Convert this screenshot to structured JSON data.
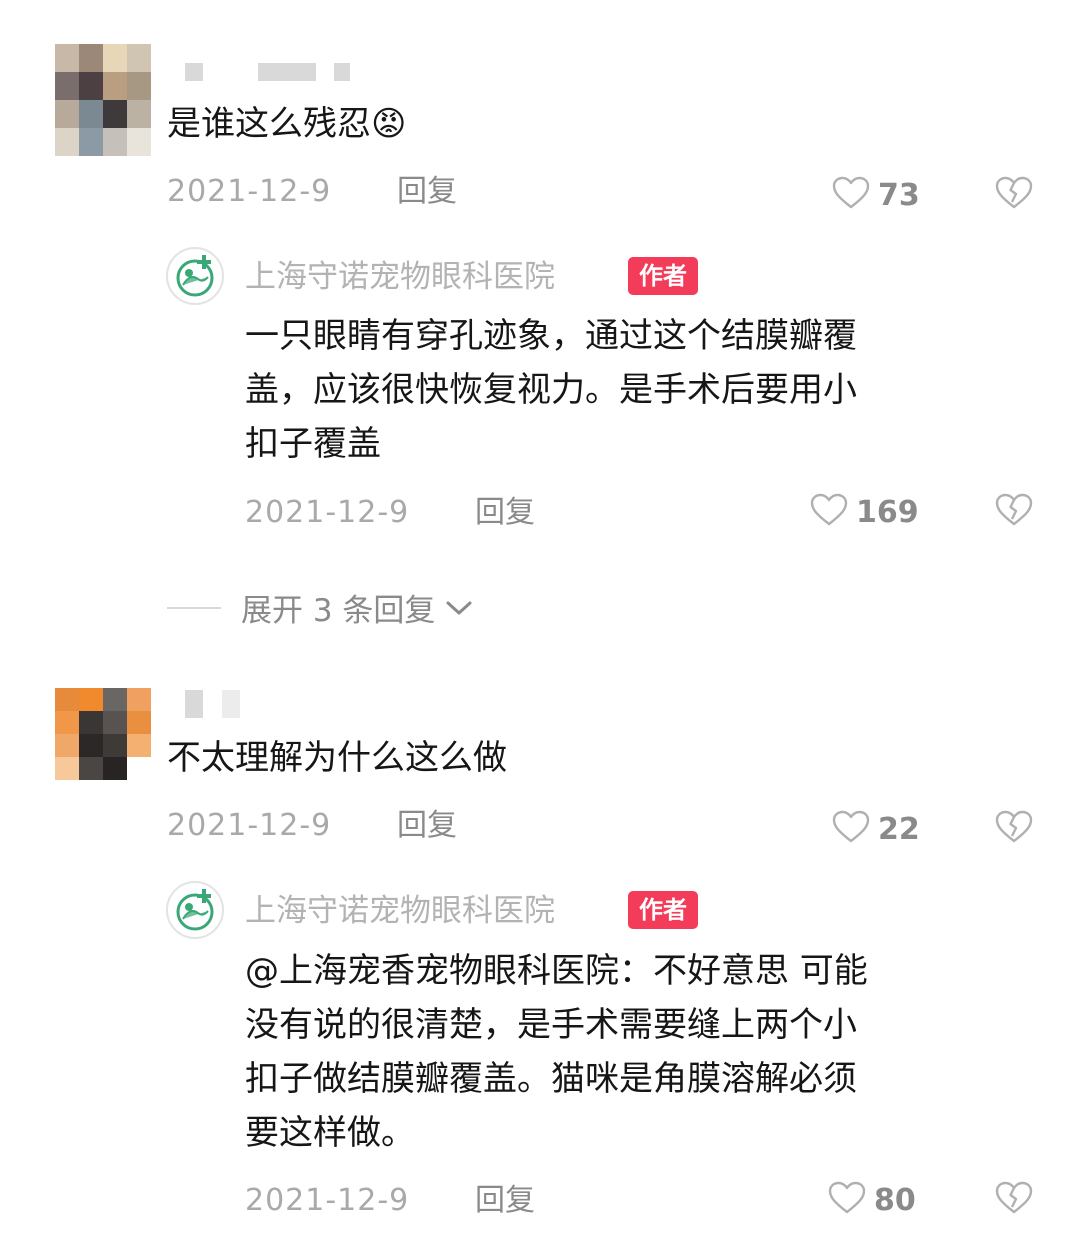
{
  "comments": [
    {
      "username": "",
      "text": "是谁这么残忍",
      "emoji": "😡",
      "date": "2021-12-9",
      "reply_label": "回复",
      "likes": "73",
      "author_reply": {
        "name": "上海守诺宠物眼科医院",
        "badge": "作者",
        "lines": [
          "一只眼睛有穿孔迹象，通过这个结膜瓣覆",
          "盖，应该很快恢复视力。是手术后要用小",
          "扣子覆盖"
        ],
        "date": "2021-12-9",
        "reply_label": "回复",
        "likes": "169"
      },
      "expand": {
        "label": "展开 3 条回复"
      }
    },
    {
      "username": "",
      "text": "不太理解为什么这么做",
      "date": "2021-12-9",
      "reply_label": "回复",
      "likes": "22",
      "author_reply": {
        "name": "上海守诺宠物眼科医院",
        "badge": "作者",
        "lines": [
          "@上海宠香宠物眼科医院：不好意思 可能",
          "没有说的很清楚，是手术需要缝上两个小",
          "扣子做结膜瓣覆盖。猫咪是角膜溶解必须",
          "要这样做。"
        ],
        "date": "2021-12-9",
        "reply_label": "回复",
        "likes": "80"
      }
    }
  ],
  "icons": {
    "like": "heart-outline-icon",
    "dislike": "broken-heart-icon",
    "expand": "chevron-down-icon"
  },
  "colors": {
    "badge": "#f23c5a",
    "meta": "#a9a9a9",
    "text": "#161616"
  }
}
